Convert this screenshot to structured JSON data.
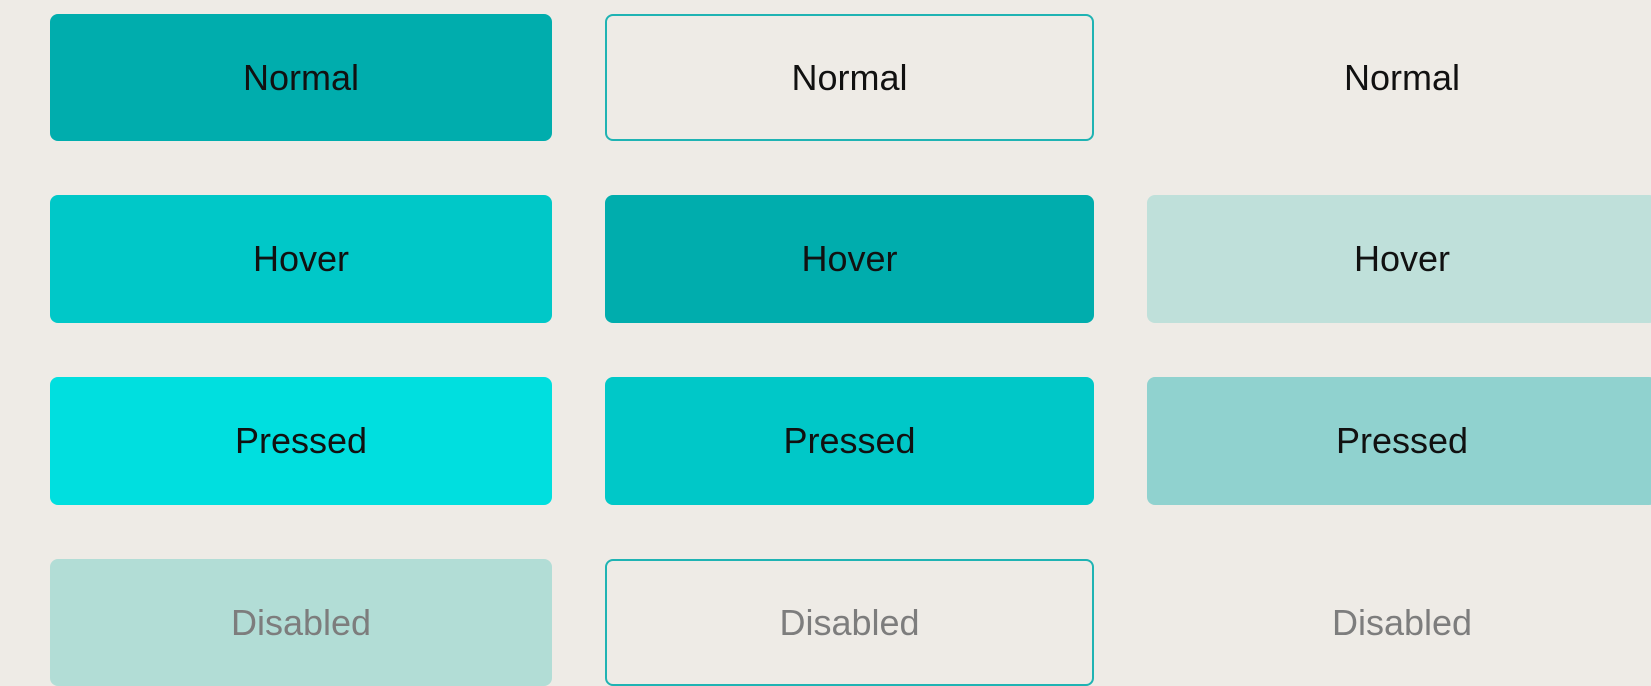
{
  "buttons": {
    "filled": {
      "normal": {
        "label": "Normal",
        "color": "#00adad"
      },
      "hover": {
        "label": "Hover",
        "color": "#00c8c8"
      },
      "pressed": {
        "label": "Pressed",
        "color": "#00dfdf"
      },
      "disabled": {
        "label": "Disabled",
        "color": "#b2ddd6"
      }
    },
    "outlined": {
      "normal": {
        "label": "Normal",
        "border_color": "#1fb3b3"
      },
      "hover": {
        "label": "Hover",
        "color": "#00adad"
      },
      "pressed": {
        "label": "Pressed",
        "color": "#00c8c8"
      },
      "disabled": {
        "label": "Disabled",
        "border_color": "#1fb3b3"
      }
    },
    "text": {
      "normal": {
        "label": "Normal"
      },
      "hover": {
        "label": "Hover",
        "color": "#bfe0da"
      },
      "pressed": {
        "label": "Pressed",
        "color": "#90d2cf"
      },
      "disabled": {
        "label": "Disabled"
      }
    }
  },
  "colors": {
    "background": "#eeebe6",
    "label_text": "#111111",
    "disabled_text": "#7d7d7d"
  }
}
